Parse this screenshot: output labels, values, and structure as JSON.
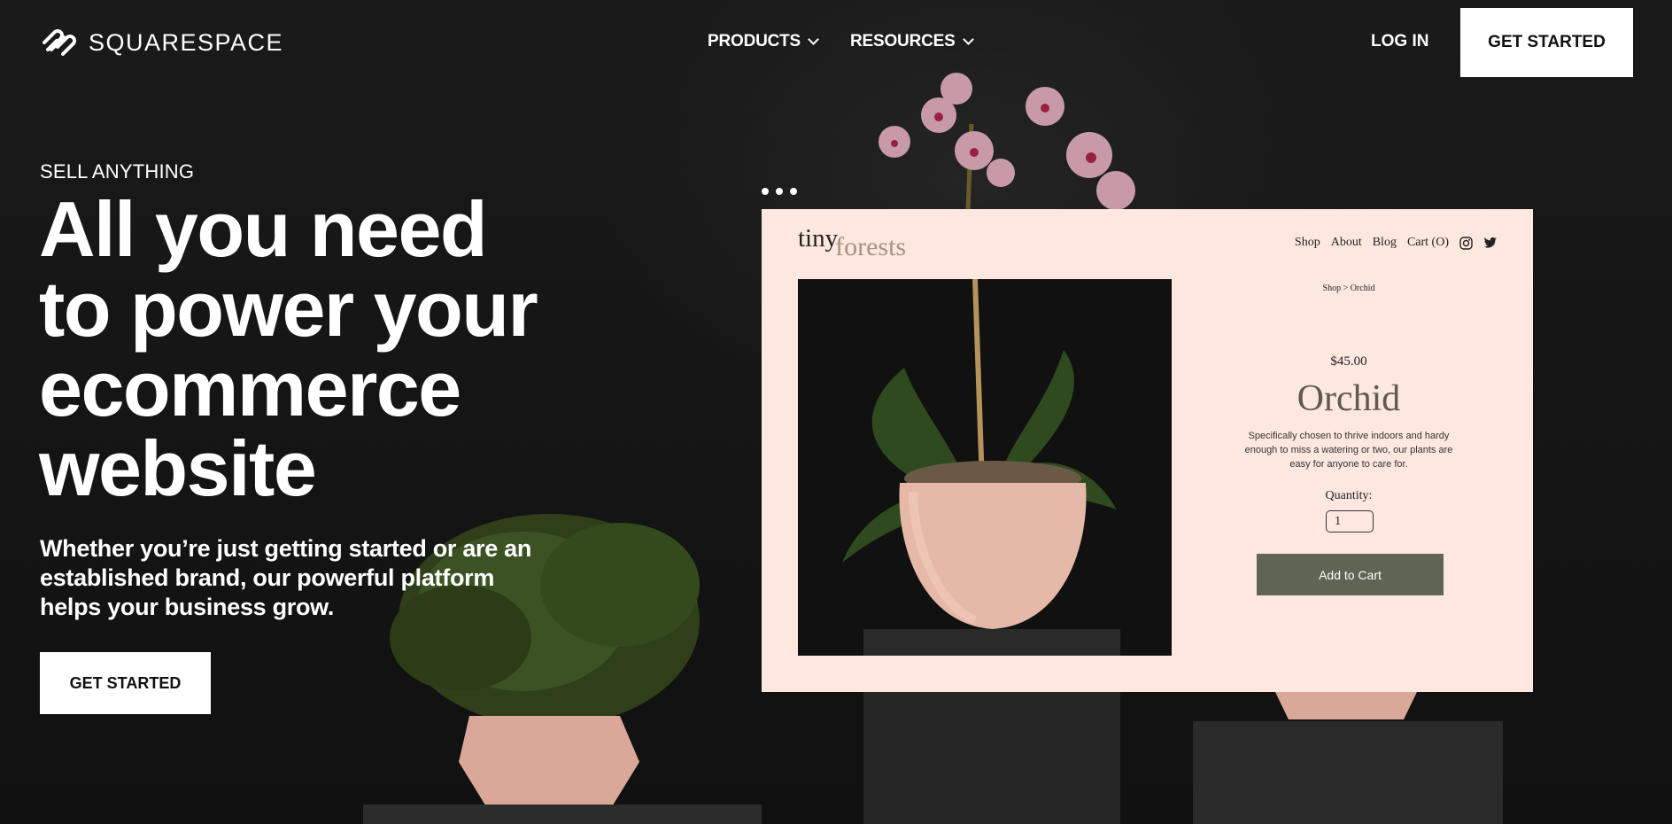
{
  "header": {
    "logo_text": "SQUARESPACE",
    "nav": [
      {
        "label": "PRODUCTS"
      },
      {
        "label": "RESOURCES"
      }
    ],
    "login_label": "LOG IN",
    "cta_label": "GET STARTED"
  },
  "hero": {
    "eyebrow": "SELL ANYTHING",
    "headline_lines": [
      "All you need",
      "to power your",
      "ecommerce",
      "website"
    ],
    "subtitle_lines": [
      "Whether you’re just getting started or are an",
      "established brand, our powerful platform",
      "helps your business grow."
    ],
    "cta_label": "GET STARTED"
  },
  "mockup": {
    "brand_part1": "tiny",
    "brand_part2": "forests",
    "nav": [
      "Shop",
      "About",
      "Blog",
      "Cart (O)"
    ],
    "breadcrumb": "Shop  >  Orchid",
    "price": "$45.00",
    "title": "Orchid",
    "description": "Specifically chosen to thrive indoors and hardy enough to miss a watering or two, our plants are easy for anyone to care for.",
    "quantity_label": "Quantity:",
    "quantity_value": "1",
    "add_to_cart": "Add to Cart"
  },
  "colors": {
    "background": "#151515",
    "mockup_bg": "#fde7de",
    "cart_button": "#5e6553",
    "pot": "#e6b8a8"
  }
}
